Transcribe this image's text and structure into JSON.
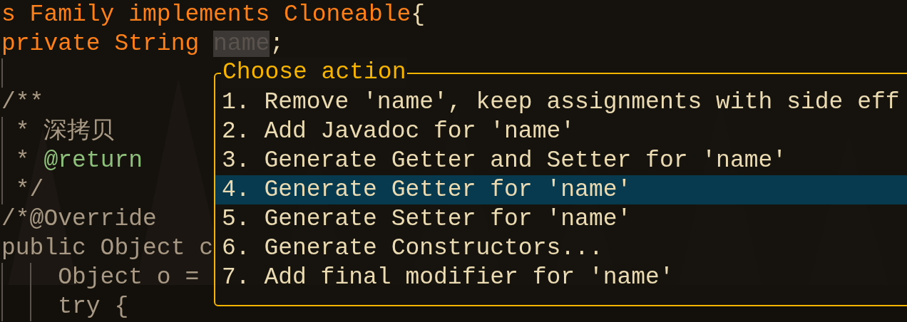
{
  "code_lines": [
    {
      "kind": "code",
      "tokens": [
        {
          "kind": "keyword",
          "text": "s Family implements Cloneable"
        },
        {
          "kind": "plain",
          "text": "{"
        }
      ]
    },
    {
      "kind": "code",
      "tokens": [
        {
          "kind": "keyword",
          "text": "private String "
        },
        {
          "kind": "highlight",
          "text": "name"
        },
        {
          "kind": "plain",
          "text": ";"
        }
      ]
    },
    {
      "kind": "blank"
    },
    {
      "kind": "code",
      "tokens": [
        {
          "kind": "comment",
          "text": "/**"
        }
      ]
    },
    {
      "kind": "code",
      "tokens": [
        {
          "kind": "comment",
          "text": " * 深拷贝"
        }
      ]
    },
    {
      "kind": "code",
      "tokens": [
        {
          "kind": "comment",
          "text": " * "
        },
        {
          "kind": "tag",
          "text": "@return"
        }
      ]
    },
    {
      "kind": "code",
      "tokens": [
        {
          "kind": "comment",
          "text": " */"
        }
      ]
    },
    {
      "kind": "code",
      "tokens": [
        {
          "kind": "comment",
          "text": "/*@Override"
        }
      ]
    },
    {
      "kind": "code",
      "tokens": [
        {
          "kind": "comment",
          "text": "public Object c"
        }
      ]
    },
    {
      "kind": "code",
      "tokens": [
        {
          "kind": "comment",
          "text": "    Object o ="
        }
      ]
    },
    {
      "kind": "code",
      "tokens": [
        {
          "kind": "comment",
          "text": "    try {"
        }
      ]
    }
  ],
  "popup": {
    "title": "Choose action",
    "items": [
      {
        "label": "1. Remove 'name', keep assignments with side eff",
        "selected": false
      },
      {
        "label": "2. Add Javadoc for 'name'",
        "selected": false
      },
      {
        "label": "3. Generate Getter and Setter for 'name'",
        "selected": false
      },
      {
        "label": "4. Generate Getter for 'name'",
        "selected": true
      },
      {
        "label": "5. Generate Setter for 'name'",
        "selected": false
      },
      {
        "label": "6. Generate Constructors...",
        "selected": false
      },
      {
        "label": "7. Add final modifier for 'name'",
        "selected": false
      }
    ]
  }
}
